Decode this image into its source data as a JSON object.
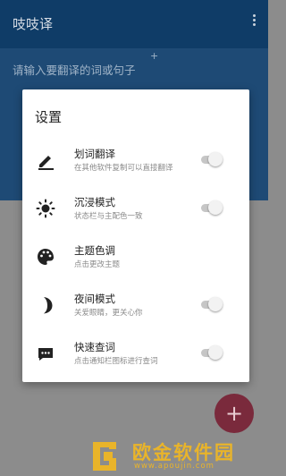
{
  "app": {
    "title": "吱吱译",
    "input_placeholder": "请输入要翻译的词或句子",
    "plus_mark": "+",
    "fab_label": "+"
  },
  "dialog": {
    "title": "设置",
    "items": [
      {
        "icon": "pencil-icon",
        "label": "划词翻译",
        "sub": "在其他软件复制可以直接翻译",
        "has_toggle": true,
        "toggle_on": false
      },
      {
        "icon": "brightness-icon",
        "label": "沉浸模式",
        "sub": "状态栏与主配色一致",
        "has_toggle": true,
        "toggle_on": false
      },
      {
        "icon": "palette-icon",
        "label": "主题色调",
        "sub": "点击更改主题",
        "has_toggle": false
      },
      {
        "icon": "moon-icon",
        "label": "夜间模式",
        "sub": "关爱眼睛，更关心你",
        "has_toggle": true,
        "toggle_on": false
      },
      {
        "icon": "chat-bubble-icon",
        "label": "快速查词",
        "sub": "点击通知栏图标进行查词",
        "has_toggle": true,
        "toggle_on": false
      }
    ]
  },
  "watermark": {
    "title": "欧金软件园",
    "url": "www.apoujin.com"
  },
  "colors": {
    "appbar": "#0f3c67",
    "input_area": "#1e4a75",
    "scrim": "#8c8c8c",
    "fab": "#7a2a3c",
    "watermark": "#e9b42a"
  }
}
